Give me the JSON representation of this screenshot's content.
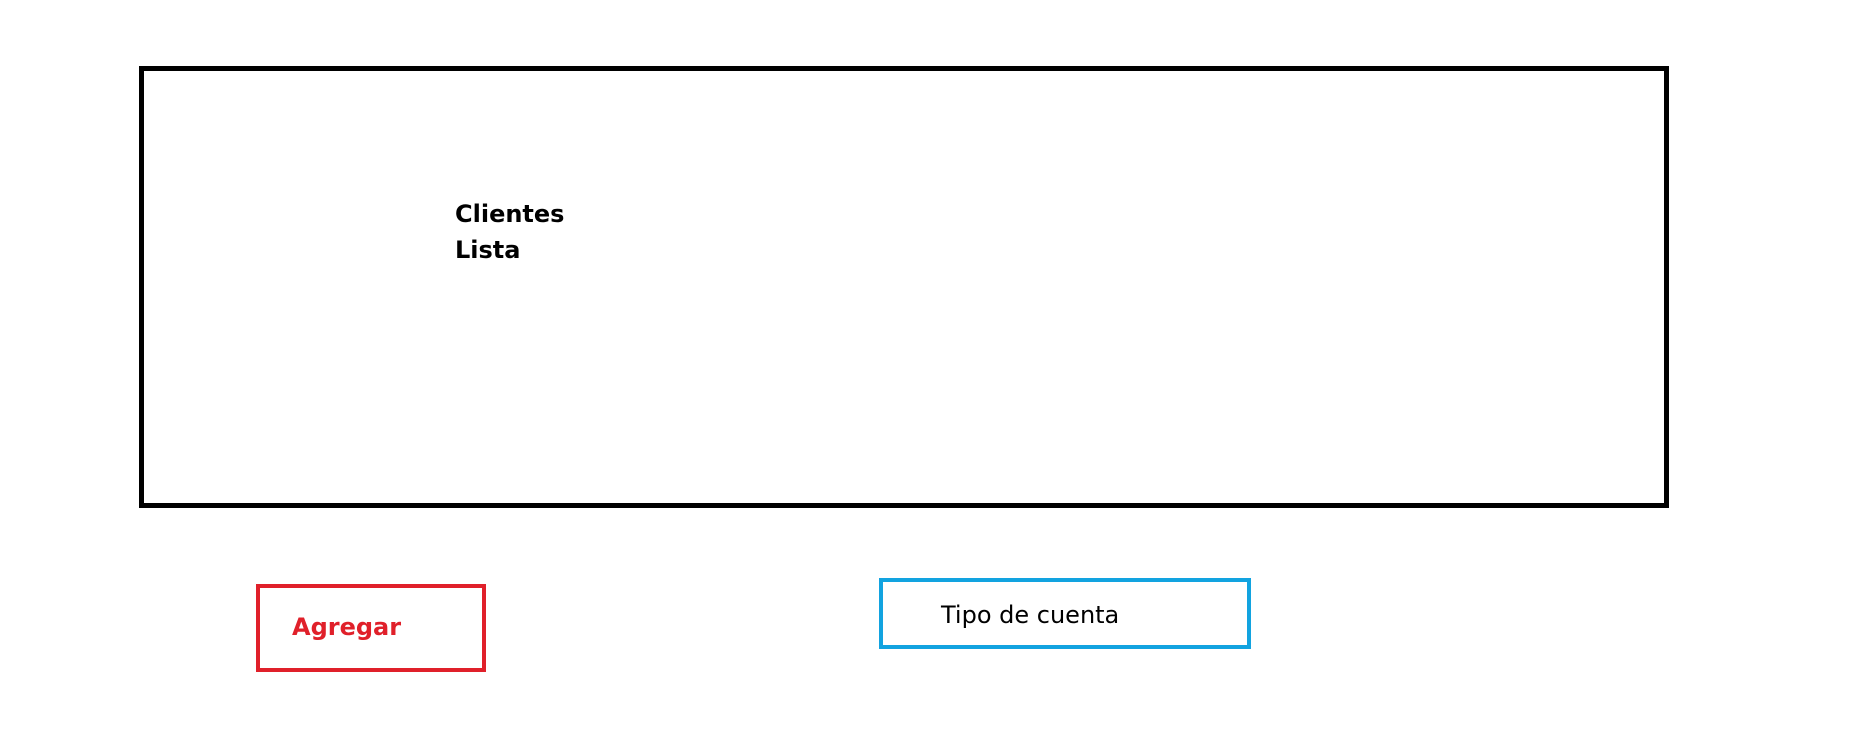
{
  "clients_list": {
    "title_line1": "Clientes",
    "title_line2": "Lista"
  },
  "actions": {
    "add_label": "Agregar",
    "account_type_label": "Tipo de cuenta"
  },
  "colors": {
    "panel_border": "#000000",
    "add_accent": "#e0202a",
    "account_accent": "#12a3e0"
  }
}
